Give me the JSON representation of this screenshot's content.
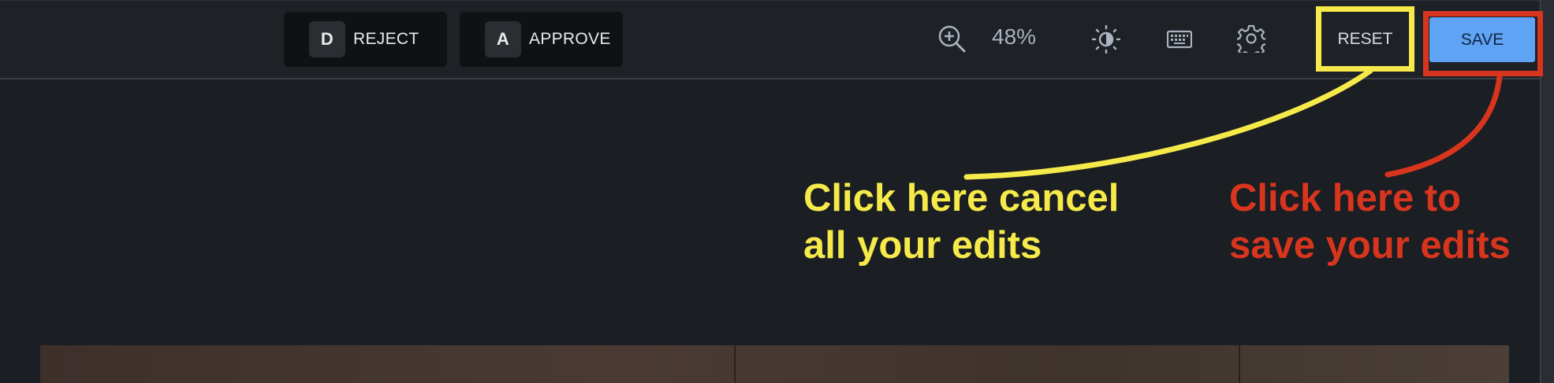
{
  "toolbar": {
    "reject": {
      "key": "D",
      "label": "REJECT"
    },
    "approve": {
      "key": "A",
      "label": "APPROVE"
    },
    "zoom_level": "48%",
    "reset_label": "RESET",
    "save_label": "SAVE"
  },
  "annotations": {
    "reset_note_line1": "Click here cancel",
    "reset_note_line2": "all your edits",
    "save_note_line1": "Click here to",
    "save_note_line2": "save your edits"
  },
  "colors": {
    "highlight_yellow": "#f5ea4a",
    "highlight_red": "#d8351f",
    "save_button": "#5fa3f5",
    "background": "#1b1e22"
  },
  "icons": [
    "zoom-in-icon",
    "contrast-icon",
    "keyboard-icon",
    "settings-gear-icon"
  ]
}
